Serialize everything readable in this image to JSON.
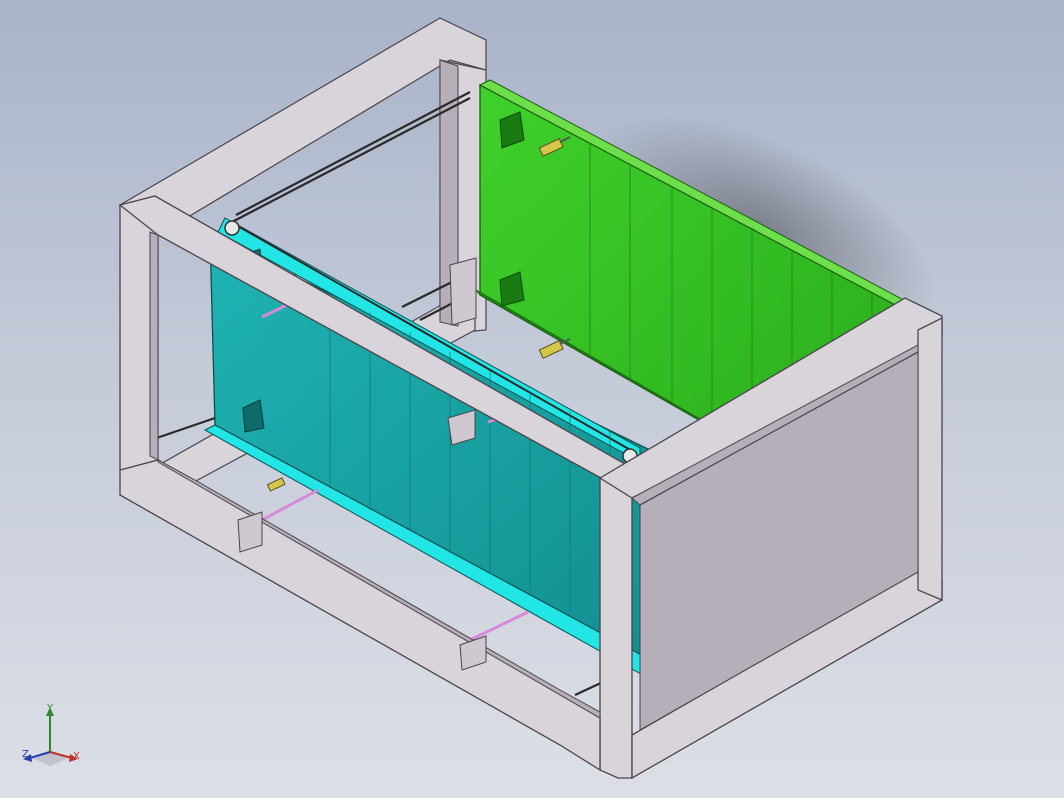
{
  "viewport": {
    "background_top": "#a9b3c9",
    "background_bottom": "#dcdfe6"
  },
  "model": {
    "frame_color": "#d9d3da",
    "frame_shadow": "#a79faa",
    "front_panel_color": "#159c9c",
    "front_panel_highlight": "#22e6e6",
    "rear_panel_color": "#2fbf1f",
    "rear_panel_edge": "#6ddf4a",
    "handle_color": "#d889d8",
    "latch_color": "#d6c64a"
  },
  "triad": {
    "x_label": "X",
    "y_label": "Y",
    "z_label": "Z",
    "x_color": "#c0302a",
    "y_color": "#2a8a2a",
    "z_color": "#2a3fa8"
  }
}
